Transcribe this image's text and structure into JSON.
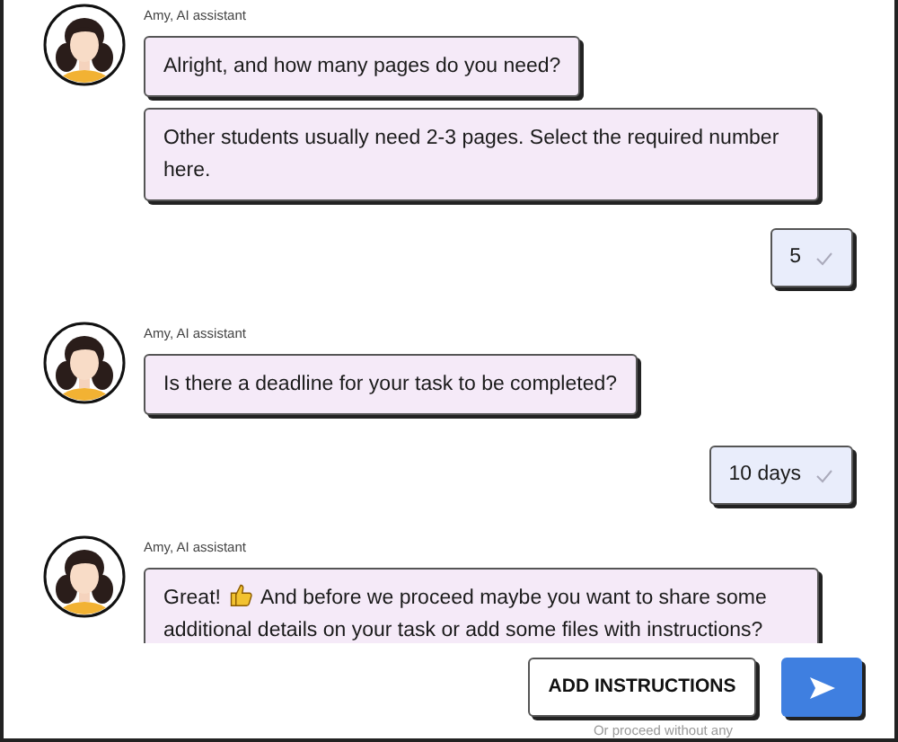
{
  "messages": [
    {
      "kind": "assistant",
      "sender": "Amy, AI assistant",
      "bubbles": [
        {
          "text": "Alright, and how many pages do you need?"
        },
        {
          "text": "Other students usually need 2-3 pages. Select the required number here."
        }
      ]
    },
    {
      "kind": "reply",
      "text": "5"
    },
    {
      "kind": "assistant",
      "sender": "Amy, AI assistant",
      "bubbles": [
        {
          "text": "Is there a deadline for your task to be completed?"
        }
      ]
    },
    {
      "kind": "reply",
      "text": "10 days"
    },
    {
      "kind": "assistant",
      "sender": "Amy, AI assistant",
      "bubbles": [
        {
          "lead": "Great!",
          "text": "And before we proceed maybe you want to share some additional details on your task or add some files with instructions?"
        }
      ]
    }
  ],
  "footer": {
    "button": "ADD INSTRUCTIONS",
    "note": "Or proceed without any"
  }
}
